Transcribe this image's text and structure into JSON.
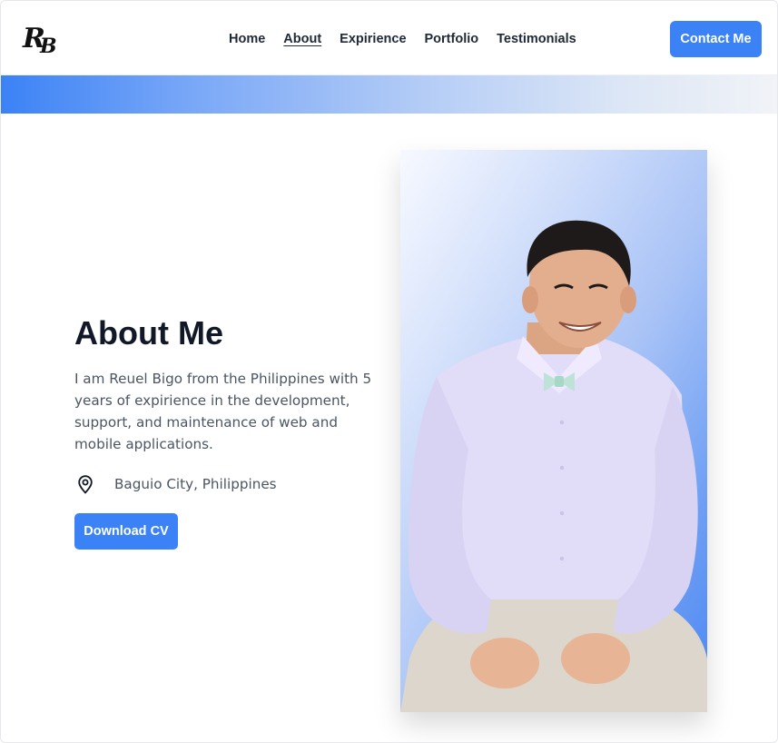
{
  "header": {
    "logo_text": "RB",
    "nav": [
      {
        "label": "Home",
        "active": false
      },
      {
        "label": "About",
        "active": true
      },
      {
        "label": "Expirience",
        "active": false
      },
      {
        "label": "Portfolio",
        "active": false
      },
      {
        "label": "Testimonials",
        "active": false
      }
    ],
    "contact_label": "Contact Me"
  },
  "about": {
    "title": "About Me",
    "description": "I am Reuel Bigo from the Philippines with 5 years of expirience in the development, support, and maintenance of web and mobile applications.",
    "location_icon": "map-pin-icon",
    "location": "Baguio City, Philippines",
    "download_label": "Download CV"
  },
  "colors": {
    "accent": "#3b82f6",
    "heading": "#111827",
    "body_text": "#4b5563"
  }
}
